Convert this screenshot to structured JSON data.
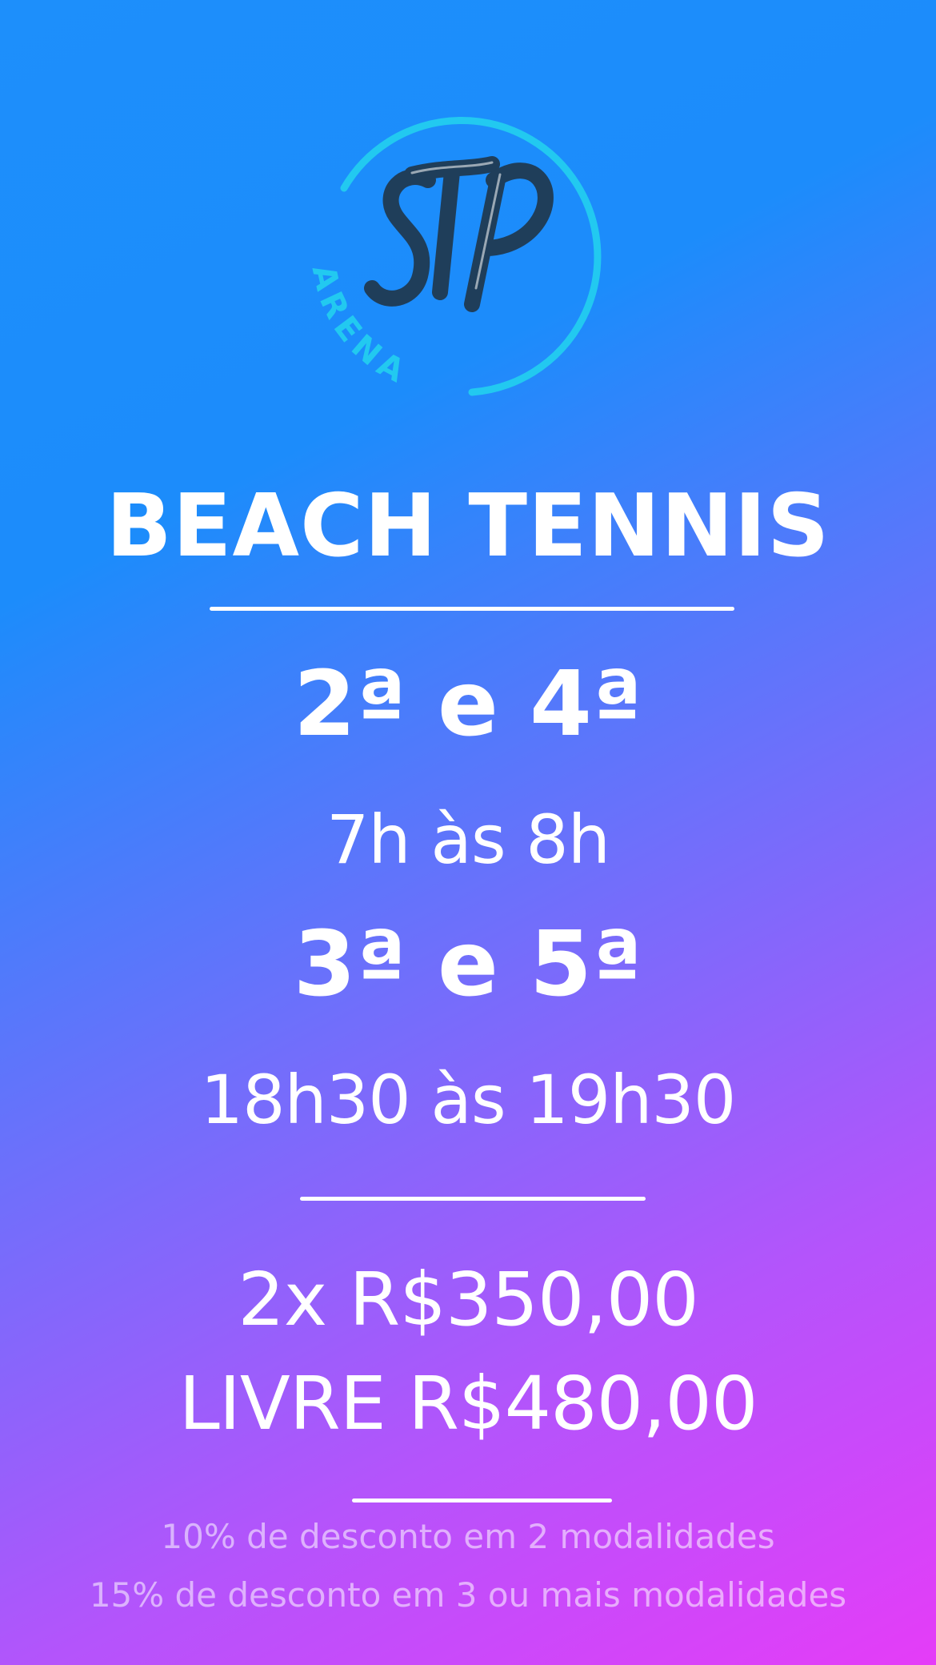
{
  "logo": {
    "monogram": "STP",
    "ring_text": "ARENA",
    "ring_color": "#22c9f0",
    "monogram_color": "#1f3e5a"
  },
  "title": "BEACH TENNIS",
  "schedule": [
    {
      "days": "2ª e 4ª",
      "hours": "7h às 8h"
    },
    {
      "days": "3ª e 5ª",
      "hours": "18h30 às 19h30"
    }
  ],
  "prices": [
    "2x R$350,00",
    "LIVRE R$480,00"
  ],
  "discounts": [
    "10% de desconto em 2 modalidades",
    "15% de desconto em 3 ou mais modalidades"
  ],
  "colors": {
    "gradient_top": "#1c8cfb",
    "gradient_bottom": "#e53cf8",
    "text": "#ffffff"
  }
}
